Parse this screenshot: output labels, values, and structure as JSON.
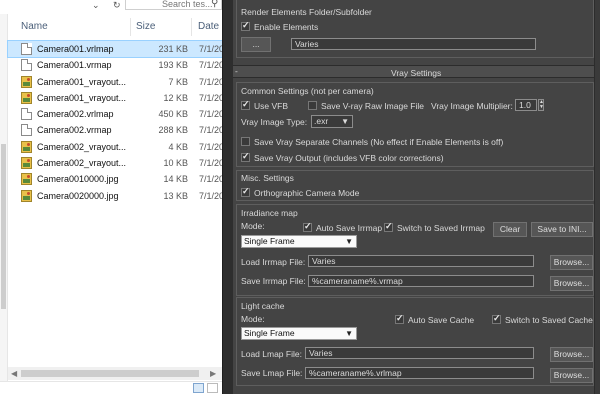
{
  "explorer": {
    "search_placeholder": "Search tes...",
    "columns": {
      "name": "Name",
      "size": "Size",
      "date": "Date"
    },
    "files": [
      {
        "name": "Camera001.vrlmap",
        "size": "231 KB",
        "date": "7/1/20",
        "icon": "file-icon",
        "selected": true
      },
      {
        "name": "Camera001.vrmap",
        "size": "193 KB",
        "date": "7/1/20",
        "icon": "file-icon"
      },
      {
        "name": "Camera001_vrayout...",
        "size": "7 KB",
        "date": "7/1/20",
        "icon": "jpg-image-icon"
      },
      {
        "name": "Camera001_vrayout...",
        "size": "12 KB",
        "date": "7/1/20",
        "icon": "jpg-image-icon"
      },
      {
        "name": "Camera002.vrlmap",
        "size": "450 KB",
        "date": "7/1/20",
        "icon": "file-icon"
      },
      {
        "name": "Camera002.vrmap",
        "size": "288 KB",
        "date": "7/1/20",
        "icon": "file-icon"
      },
      {
        "name": "Camera002_vrayout...",
        "size": "4 KB",
        "date": "7/1/20",
        "icon": "jpg-image-icon"
      },
      {
        "name": "Camera002_vrayout...",
        "size": "10 KB",
        "date": "7/1/20",
        "icon": "jpg-image-icon"
      },
      {
        "name": "Camera0010000.jpg",
        "size": "14 KB",
        "date": "7/1/20",
        "icon": "jpg-image-icon"
      },
      {
        "name": "Camera0020000.jpg",
        "size": "13 KB",
        "date": "7/1/20",
        "icon": "jpg-image-icon"
      }
    ]
  },
  "render_elements": {
    "title": "Render Elements Folder/Subfolder",
    "enable_label": "Enable Elements",
    "enable_checked": true,
    "browse_label": "...",
    "path_value": "Varies"
  },
  "vray_settings": {
    "rollout_title": "Vray Settings",
    "rollout_toggle": "-",
    "common": {
      "title": "Common Settings (not per camera)",
      "use_vfb": "Use VFB",
      "use_vfb_checked": true,
      "save_raw": "Save V-ray Raw Image File",
      "save_raw_checked": false,
      "multiplier_label": "Vray Image Multiplier:",
      "multiplier_value": "1.0",
      "image_type_label": "Vray Image Type:",
      "image_type_value": ".exr",
      "save_separate": "Save Vray Separate Channels (No effect if Enable Elements is off)",
      "save_separate_checked": false,
      "save_output": "Save Vray Output (includes VFB color corrections)",
      "save_output_checked": true
    },
    "misc": {
      "title": "Misc. Settings",
      "ortho": "Orthographic Camera Mode",
      "ortho_checked": true
    },
    "irradiance": {
      "title": "Irradiance map",
      "mode_label": "Mode:",
      "auto_save": "Auto Save Irrmap",
      "auto_save_checked": true,
      "switch_saved": "Switch to Saved Irrmap",
      "switch_saved_checked": true,
      "clear_label": "Clear",
      "save_ini_label": "Save to INI...",
      "mode_value": "Single Frame",
      "load_label": "Load Irrmap File:",
      "load_value": "Varies",
      "save_label": "Save Irrmap File:",
      "save_value": "%cameraname%.vrmap",
      "browse_label": "Browse..."
    },
    "light_cache": {
      "title": "Light cache",
      "mode_label": "Mode:",
      "auto_save": "Auto Save Cache",
      "auto_save_checked": true,
      "switch_saved": "Switch to Saved Cache",
      "switch_saved_checked": true,
      "mode_value": "Single Frame",
      "load_label": "Load Lmap File:",
      "load_value": "Varies",
      "save_label": "Save Lmap File:",
      "save_value": "%cameraname%.vrlmap",
      "browse_label": "Browse..."
    }
  }
}
